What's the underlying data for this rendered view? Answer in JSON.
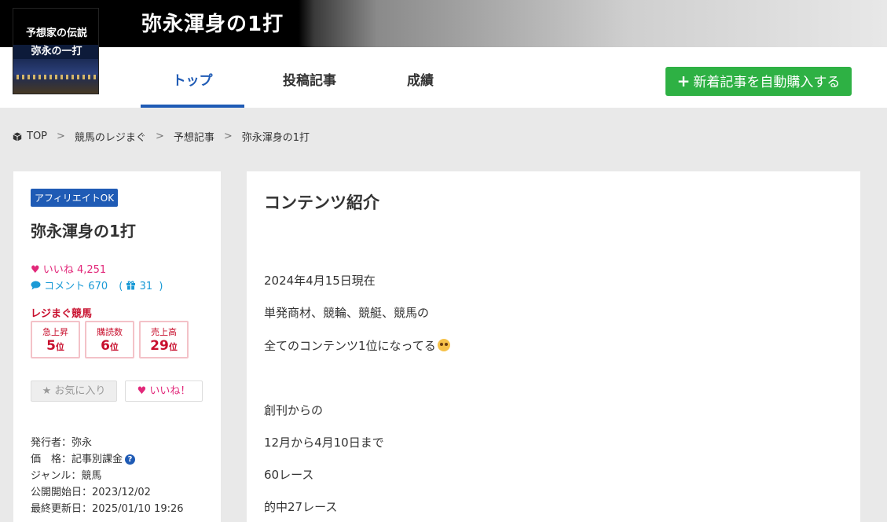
{
  "header": {
    "banner_title": "弥永渾身の1打",
    "logo_line1": "予想家の伝説",
    "logo_line2": "弥永の一打",
    "tabs": [
      {
        "label": "トップ",
        "active": true
      },
      {
        "label": "投稿記事",
        "active": false
      },
      {
        "label": "成績",
        "active": false
      }
    ],
    "auto_buy_label": "新着記事を自動購入する",
    "accent_color": "#1f5bb5",
    "button_color": "#2eb144"
  },
  "breadcrumb": [
    "TOP",
    "競馬のレジまぐ",
    "予想記事",
    "弥永渾身の1打"
  ],
  "sidebar": {
    "affiliate_badge": "アフィリエイトOK",
    "title": "弥永渾身の1打",
    "likes_label": "いいね",
    "likes_count": "4,251",
    "comments_label": "コメント",
    "comments_count": "670",
    "gifts_count": "31",
    "ranking_label": "レジまぐ競馬",
    "rankings": [
      {
        "label": "急上昇",
        "value": "5",
        "unit": "位"
      },
      {
        "label": "購読数",
        "value": "6",
        "unit": "位"
      },
      {
        "label": "売上高",
        "value": "29",
        "unit": "位"
      }
    ],
    "favorite_label": "お気に入り",
    "good_label": "いいね！",
    "meta": [
      "発行者：弥永",
      "価　格：記事別課金",
      "ジャンル：競馬",
      "公開開始日：2023/12/02",
      "最終更新日：2025/01/10 19:26"
    ]
  },
  "main": {
    "heading": "コンテンツ紹介",
    "paragraphs": [
      "2024年4月15日現在",
      "単発商材、競輪、競艇、競馬の",
      "全てのコンテンツ1位になってる",
      "創刊からの",
      "12月から4月10日まで",
      "60レース",
      "的中27レース"
    ]
  }
}
